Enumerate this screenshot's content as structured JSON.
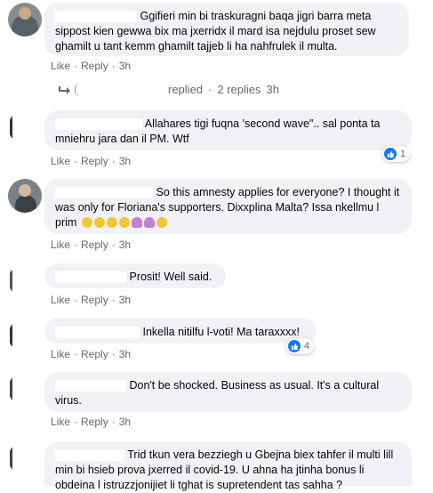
{
  "colors": {
    "bubble_bg": "#f0f2f5",
    "meta_text": "#65676b",
    "like_blue": "#1877f2"
  },
  "actions": {
    "like": "Like",
    "reply": "Reply",
    "sep": "·"
  },
  "comments": [
    {
      "text": "Ggifieri min bi traskuragni baqa jigri barra meta sippost kien gewwa bix ma jxerridx il mard isa nejdulu proset sew ghamilt u tant kemm ghamilt tajjeb li ha nahfrulek il multa.",
      "time": "3h",
      "reply_summary": {
        "icon": "reply-arrow-icon",
        "replied": "replied",
        "count": "2 replies",
        "time": "3h"
      }
    },
    {
      "text": "Allahares tigi fuqna 'second wave\".. sal ponta ta mniehru jara dan il PM. Wtf",
      "time": "3h",
      "reactions": "1"
    },
    {
      "text": "So this amnesty applies for everyone? I thought it was only for Floriana's supporters. Dixxplina Malta? Issa nkellmu l prim",
      "time": "3h",
      "emojis": [
        "face-emoji",
        "face-emoji",
        "face-emoji",
        "face-emoji",
        "woman-facepalming-emoji",
        "woman-facepalming-emoji",
        "face-emoji"
      ]
    },
    {
      "text": "Prosit! Well said.",
      "time": "3h"
    },
    {
      "text": "Inkella nitilfu l-voti! Ma taraxxxx!",
      "time": "3h",
      "reactions": "4"
    },
    {
      "text": "Don't be shocked. Business as usual. It's a cultural virus.",
      "time": "3h"
    },
    {
      "text": "Trid tkun vera bezziegh u Gbejna biex tahfer il multi lill min bi hsieb prova jxerred il covid-19. U ahna ha jtinha bonus li obdeina l istruzzjonijiet li tghat is supretendent tas sahha ?",
      "time": ""
    }
  ]
}
